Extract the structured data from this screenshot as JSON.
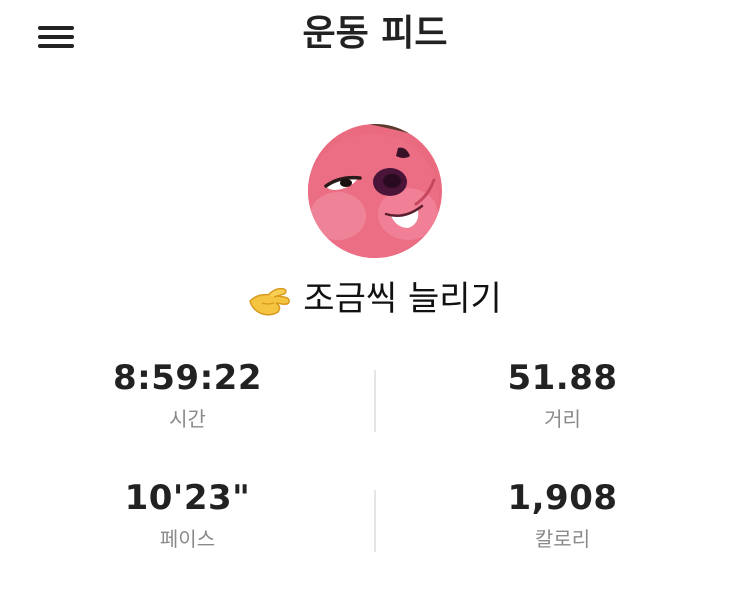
{
  "header": {
    "title": "운동 피드",
    "menu_icon": "hamburger-menu-icon"
  },
  "profile": {
    "avatar": "pink-cartoon-face-avatar",
    "status_icon": "pinching-hand-icon",
    "name": "조금씩 늘리기"
  },
  "stats": {
    "time": {
      "value": "8:59:22",
      "label": "시간"
    },
    "distance": {
      "value": "51.88",
      "label": "거리"
    },
    "pace": {
      "value": "10'23\"",
      "label": "페이스"
    },
    "calories": {
      "value": "1,908",
      "label": "칼로리"
    }
  },
  "colors": {
    "text": "#222222",
    "label": "#8a8a8a",
    "divider": "#e6e6e6",
    "avatar_pink": "#e8667a"
  }
}
